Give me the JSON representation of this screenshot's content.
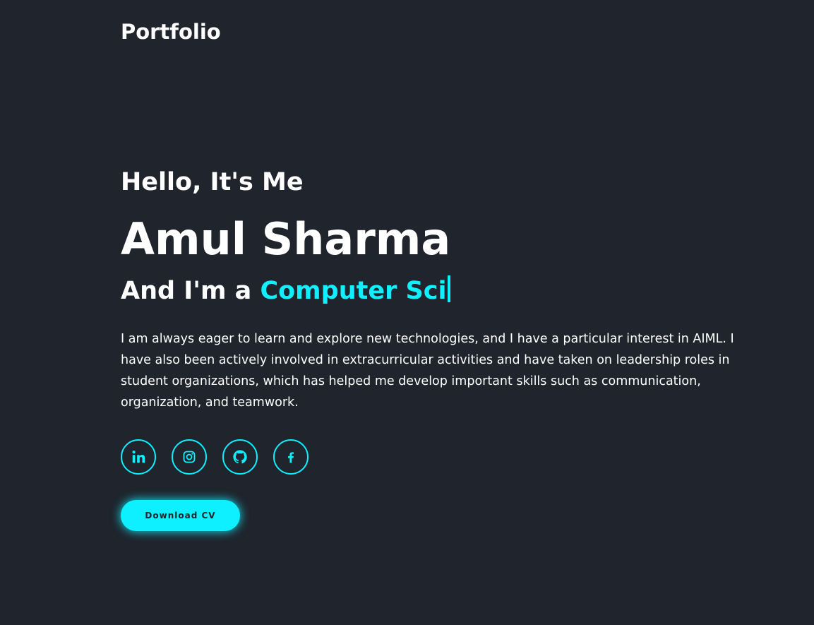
{
  "header": {
    "logo": "Portfolio"
  },
  "home": {
    "greeting": "Hello, It's Me",
    "name": "Amul Sharma",
    "role_prefix": "And I'm a ",
    "role_typed": "Computer Sci",
    "bio": "I am always eager to learn and explore new technologies, and I have a particular interest in AIML. I have also been actively involved in extracurricular activities and have taken on leadership roles in student organizations, which has helped me develop important skills such as communication, organization, and teamwork.",
    "socials": [
      {
        "icon": "linkedin-icon"
      },
      {
        "icon": "instagram-icon"
      },
      {
        "icon": "github-icon"
      },
      {
        "icon": "facebook-icon"
      }
    ],
    "cv_button": "Download CV"
  },
  "colors": {
    "background": "#1f242d",
    "accent": "#0ef0ff",
    "text": "#ffffff"
  }
}
